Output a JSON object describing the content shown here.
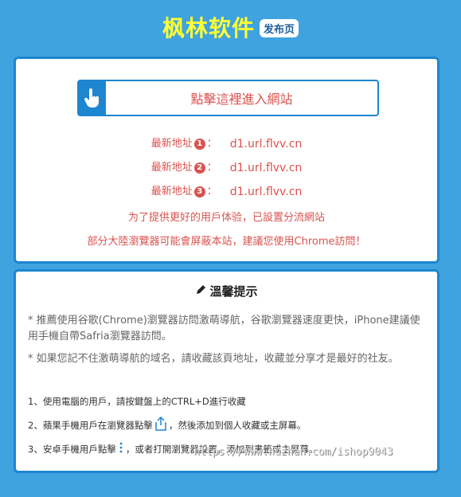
{
  "header": {
    "brand": "枫林软件",
    "badge": "发布页"
  },
  "main": {
    "enter_button": "點擊這裡進入網站",
    "addresses": [
      {
        "label": "最新地址",
        "num": "1",
        "sep": "：",
        "url": "d1.url.flvv.cn"
      },
      {
        "label": "最新地址",
        "num": "2",
        "sep": "：",
        "url": "d1.url.flvv.cn"
      },
      {
        "label": "最新地址",
        "num": "3",
        "sep": "：",
        "url": "d1.url.flvv.cn"
      }
    ],
    "notice1": "为了提供更好的用戶体验，已設置分流網站",
    "notice2": "部分大陸瀏覽器可能會屏蔽本站，建議您使用Chrome訪問！"
  },
  "tips": {
    "title": "溫馨提示",
    "para1": "* 推薦使用谷歌(Chrome)瀏覽器訪問激萌導航，谷歌瀏覽器速度更快，iPhone建議使用手機自帶Safria瀏覽器訪問。",
    "para2": "* 如果您記不住激萌導航的域名，請收藏該頁地址，收藏並分享才是最好的社友。",
    "step1": "1、使用電腦的用戶，請按鍵盤上的CTRL+D進行收藏",
    "step2a": "2、蘋果手機用戶在瀏覽器點擊",
    "step2b": "，然後添加到個人收藏或主屏幕。",
    "step3a": "3、安卓手機用戶點擊",
    "step3b": "，或者打開瀏覽器設置，添加到書籤或主屏幕。"
  },
  "watermark": "https://www.huzhan.com/ishop9043",
  "colors": {
    "background": "#3fa3e0",
    "border": "#1d86cf",
    "brand": "#ffff33",
    "accent_red": "#d9534f"
  },
  "icons": {
    "enter": "hand-pointer-icon",
    "tips": "pencil-icon",
    "share": "share-icon",
    "menu": "kebab-menu-icon"
  }
}
